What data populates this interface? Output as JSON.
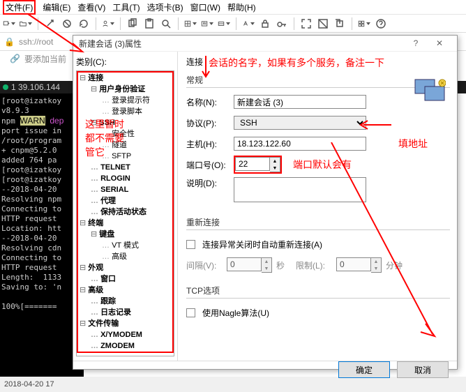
{
  "menu": {
    "file": "文件(F)",
    "edit": "编辑(E)",
    "view": "查看(V)",
    "tools": "工具(T)",
    "tabs": "选项卡(B)",
    "window": "窗口(W)",
    "help": "帮助(H)"
  },
  "tab": {
    "ssh": "ssh://root",
    "add": "要添加当前"
  },
  "status": {
    "ip": "1 39.106.144"
  },
  "terminal": "[root@izatkoy\nv8.9.3\nnpm \u001bWARN\u001b dep\nport issue in\n/root/program\n+ cnpm@5.2.0\nadded 764 pa\n[root@izatkoy\n[root@izatkoy\n--2018-04-20\nResolving npm\nConnecting to\nHTTP request \nLocation: htt\n--2018-04-20\nResolving cdn\nConnecting to\nHTTP request \nLength:  1133\nSaving to: 'n\n\n100%[=======",
  "footer": "2018-04-20 17",
  "dialog": {
    "title": "新建会话 (3)属性",
    "tree_label": "类别(C):",
    "tree": {
      "connection": "连接",
      "auth": "用户身份验证",
      "prompt": "登录提示符",
      "script": "登录脚本",
      "ssh": "SSH",
      "security": "安全性",
      "tunnel": "隧道",
      "sftp": "SFTP",
      "telnet": "TELNET",
      "rlogin": "RLOGIN",
      "serial": "SERIAL",
      "proxy": "代理",
      "keepalive": "保持活动状态",
      "terminal": "终端",
      "keyboard": "键盘",
      "vt": "VT 模式",
      "advanced": "高级",
      "appearance": "外观",
      "window": "窗口",
      "advanced2": "高级",
      "trace": "跟踪",
      "log": "日志记录",
      "transfer": "文件传输",
      "xymodem": "X/YMODEM",
      "zmodem": "ZMODEM"
    },
    "tree_annot1": "这里暂时",
    "tree_annot2": "都不需要",
    "tree_annot3": "管它",
    "conn": {
      "group": "连接",
      "annot_top": "会话的名字，如果有多个服务，备注一下",
      "general": "常规",
      "name_lbl": "名称(N):",
      "name_val": "新建会话 (3)",
      "proto_lbl": "协议(P):",
      "proto_val": "SSH",
      "host_lbl": "主机(H):",
      "host_val": "18.123.122.60",
      "host_annot": "填地址",
      "port_lbl": "端口号(O):",
      "port_val": "22",
      "port_annot": "端口默认会有",
      "desc_lbl": "说明(D):"
    },
    "reconn": {
      "group": "重新连接",
      "cb": "连接异常关闭时自动重新连接(A)",
      "interval_lbl": "间隔(V):",
      "interval_val": "0",
      "sec": "秒",
      "limit_lbl": "限制(L):",
      "limit_val": "0",
      "min": "分钟"
    },
    "tcp": {
      "group": "TCP选项",
      "nagle": "使用Nagle算法(U)"
    },
    "ok": "确定",
    "cancel": "取消"
  }
}
